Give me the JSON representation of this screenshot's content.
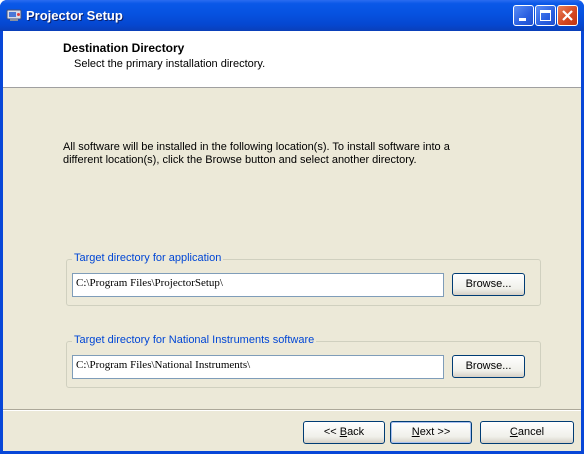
{
  "window": {
    "title": "Projector Setup"
  },
  "header": {
    "title": "Destination Directory",
    "subtitle": "Select the primary installation directory."
  },
  "description": "All software will be installed in the following location(s). To install software into a different location(s), click the Browse button and select another directory.",
  "groups": [
    {
      "label": "Target directory for application",
      "path": "C:\\Program Files\\ProjectorSetup\\",
      "browse_label": "Browse..."
    },
    {
      "label": "Target directory for National Instruments software",
      "path": "C:\\Program Files\\National Instruments\\",
      "browse_label": "Browse..."
    }
  ],
  "buttons": {
    "back": {
      "pre": "<< ",
      "mnemonic": "B",
      "post": "ack"
    },
    "next": {
      "pre": "",
      "mnemonic": "N",
      "post": "ext >>"
    },
    "cancel": {
      "pre": "",
      "mnemonic": "C",
      "post": "ancel"
    }
  },
  "colors": {
    "titlebar": "#0a58e8",
    "client": "#ece9d8",
    "group_label": "#0046d5"
  },
  "icons": [
    "app-icon",
    "minimize-icon",
    "maximize-icon",
    "close-icon"
  ]
}
